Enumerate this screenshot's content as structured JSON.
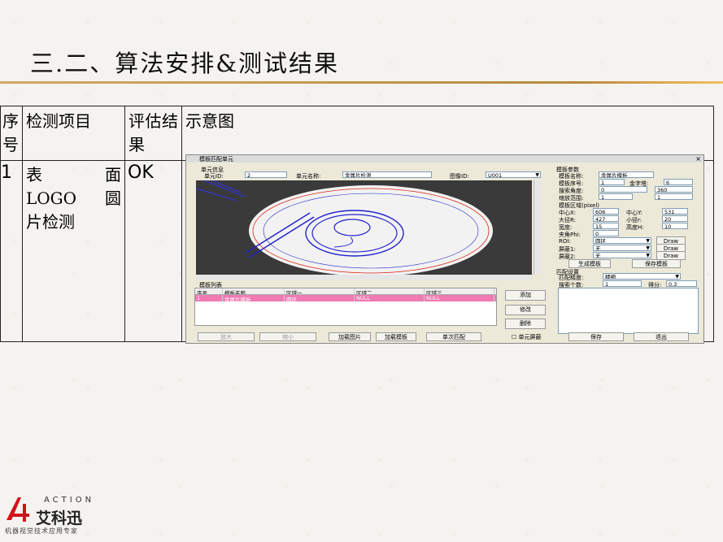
{
  "slide": {
    "title": "三.二、算法安排&测试结果"
  },
  "table": {
    "headers": {
      "index": "序号",
      "item": "检测项目",
      "eval": "评估结果",
      "diagram": "示意图"
    },
    "row": {
      "index": "1",
      "item_lines": [
        "表　面",
        "LOGO圆",
        "片检测"
      ],
      "result": "OK"
    }
  },
  "screenshot": {
    "window_title": "模板匹配单元",
    "unit_info_label": "单元信息",
    "unit_id_label": "单元ID:",
    "unit_id": "2",
    "unit_name_label": "单元名称:",
    "unit_name": "金属片检测",
    "image_id_label": "图像ID:",
    "image_id": "U001",
    "template_params_label": "模板参数",
    "template_name_label": "模板名称:",
    "template_name": "金属片模板",
    "template_no_label": "模板序号:",
    "template_no": "1",
    "pyramid_label": "金字塔:",
    "pyramid": "6",
    "search_angle_label": "搜索角度:",
    "search_angle_from": "0",
    "search_angle_to": "360",
    "scale_range_label": "缩放范围:",
    "scale_from": "1",
    "scale_to": "1",
    "roi_region_label": "模板区域(pixel)",
    "center_x_label": "中心X:",
    "center_x": "606",
    "center_y_label": "中心Y:",
    "center_y": "531",
    "outer_r_label": "大径R:",
    "outer_r": "427",
    "inner_r_label": "小径r:",
    "inner_r": "20",
    "width_label": "宽度:",
    "width": "15",
    "height_label": "高度H:",
    "height": "10",
    "angle_label": "夹角Phi:",
    "angle": "0",
    "roi_label": "ROI:",
    "roi": "圆环",
    "mask1_label": "屏蔽1:",
    "mask1": "无",
    "mask2_label": "屏蔽2:",
    "mask2": "无",
    "draw_label": "Draw",
    "gen_template": "生成模板",
    "save_template": "保存模板",
    "match_settings_label": "匹配设置",
    "match_precision_label": "匹配精度:",
    "match_precision": "精细",
    "search_count_label": "搜索个数:",
    "search_count": "1",
    "score_label": "得分:",
    "score": "0.3",
    "list_label": "模板列表",
    "list_headers": [
      "序号",
      "模板名称",
      "区域一",
      "区域二",
      "区域三"
    ],
    "list_row": [
      "1",
      "金属片模板",
      "圆环",
      "NULL",
      "NULL"
    ],
    "add_btn": "添加",
    "edit_btn": "修改",
    "delete_btn": "删除",
    "zoom_in": "放大",
    "zoom_out": "缩小",
    "load_image": "加载图片",
    "load_template": "加载模板",
    "single_match": "单次匹配",
    "unit_mask": "单元屏蔽",
    "save": "保存",
    "exit": "退出"
  },
  "logo": {
    "en": "ACTION",
    "cn": "艾科迅",
    "sub": "机器视觉技术应用专家",
    "brand_color": "#d4111a"
  }
}
